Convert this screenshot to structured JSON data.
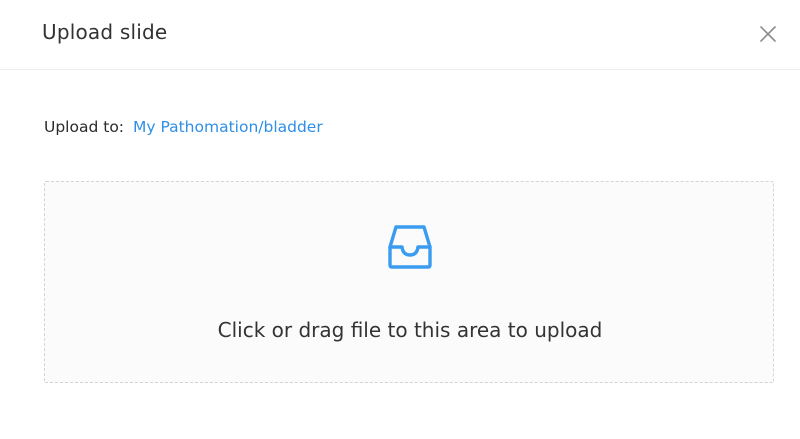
{
  "dialog": {
    "title": "Upload slide",
    "close_icon": "close-icon"
  },
  "upload_to": {
    "label": "Upload to:",
    "path": "My Pathomation/bladder",
    "link_color": "#2f8fe8"
  },
  "dropzone": {
    "icon": "inbox-icon",
    "icon_color": "#3a9cf0",
    "text": "Click or drag file to this area to upload"
  }
}
